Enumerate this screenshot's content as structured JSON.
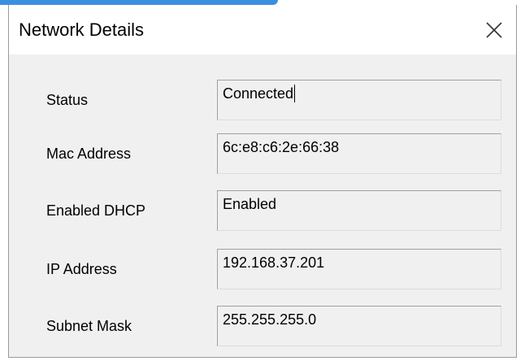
{
  "window": {
    "title": "Network Details",
    "close_icon": "close-icon"
  },
  "fields": [
    {
      "label": "Status",
      "value": "Connected"
    },
    {
      "label": "Mac Address",
      "value": "6c:e8:c6:2e:66:38"
    },
    {
      "label": "Enabled DHCP",
      "value": "Enabled"
    },
    {
      "label": "IP Address",
      "value": "192.168.37.201"
    },
    {
      "label": "Subnet Mask",
      "value": "255.255.255.0"
    }
  ]
}
